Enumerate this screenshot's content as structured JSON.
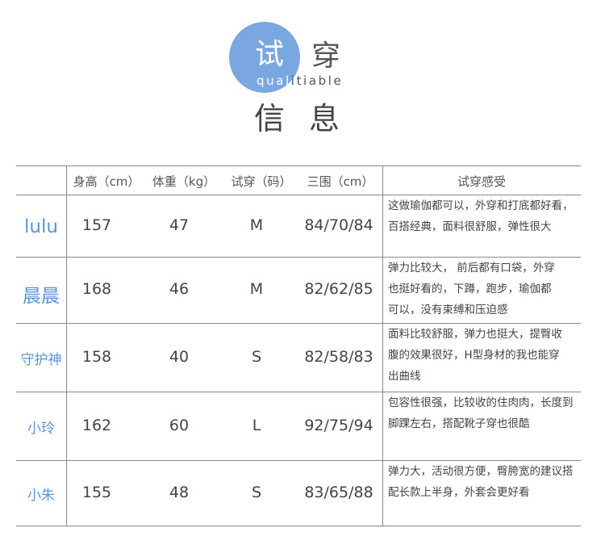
{
  "title": {
    "circle_char": "试",
    "second_char": "穿",
    "subtitle_part1": "qual",
    "subtitle_part2": "itiable",
    "line2": "信息"
  },
  "table": {
    "headers": [
      "身高（cm）",
      "体重（kg）",
      "试穿（码）",
      "三围（cm）",
      "试穿感受"
    ],
    "rows": [
      {
        "name": "lulu",
        "height": "157",
        "weight": "47",
        "size": "M",
        "measurements": "84/70/84",
        "notes": [
          "这做瑜伽都可以，外穿和打底都好看，",
          "百搭经典，面料很舒服，弹性很大"
        ]
      },
      {
        "name": "晨晨",
        "height": "168",
        "weight": "46",
        "size": "M",
        "measurements": "82/62/85",
        "notes": [
          "弹力比较大， 前后都有口袋，外穿",
          "也挺好看的，下蹲，跑步，瑜伽都",
          "可以，没有束缚和压迫感"
        ]
      },
      {
        "name": "守护神",
        "height": "158",
        "weight": "40",
        "size": "S",
        "measurements": "82/58/83",
        "notes": [
          "面料比较舒服，弹力也挺大，提臀收",
          "腹的效果很好，H型身材的我也能穿",
          "出曲线"
        ]
      },
      {
        "name": "小玲",
        "height": "162",
        "weight": "60",
        "size": "L",
        "measurements": "92/75/94",
        "notes": [
          "包容性很强，比较收的住肉肉，长度到",
          "脚踝左右，搭配靴子穿也很酷"
        ]
      },
      {
        "name": "小朱",
        "height": "155",
        "weight": "48",
        "size": "S",
        "measurements": "83/65/88",
        "notes": [
          "弹力大，活动很方便，臀胯宽的建议搭",
          "配长款上半身，外套会更好看"
        ]
      }
    ]
  },
  "colors": {
    "accent": "#7ba7e0",
    "name": "#5b95d8"
  }
}
